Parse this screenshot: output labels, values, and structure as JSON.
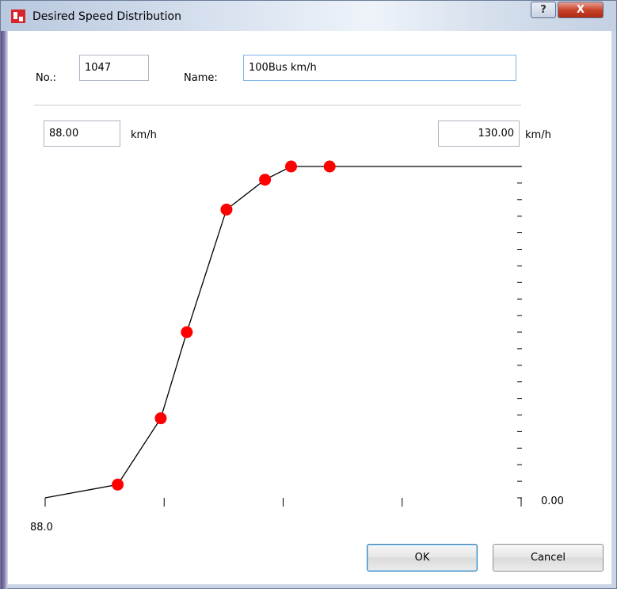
{
  "window": {
    "title": "Desired Speed Distribution",
    "help_label": "?",
    "close_label": "X"
  },
  "form": {
    "no_label": "No.:",
    "no_value": "1047",
    "name_label": "Name:",
    "name_value": "100Bus km/h"
  },
  "range": {
    "min_value": "88.00",
    "max_value": "130.00",
    "unit": "km/h"
  },
  "chart_data": {
    "type": "line",
    "x_min": 88.0,
    "x_max": 130.0,
    "y_min": 0.0,
    "y_max": 1.0,
    "x_tick_label": "88.0",
    "y_tick_label": "0.00",
    "x_ticks": [
      88.0,
      98.5,
      109.0,
      119.5,
      130.0
    ],
    "y_ticks": [
      0.0,
      0.05,
      0.1,
      0.15,
      0.2,
      0.25,
      0.3,
      0.35,
      0.4,
      0.45,
      0.5,
      0.55,
      0.6,
      0.65,
      0.7,
      0.75,
      0.8,
      0.85,
      0.9,
      0.95,
      1.0
    ],
    "points": [
      {
        "x": 88.0,
        "y": 0.0
      },
      {
        "x": 94.4,
        "y": 0.04
      },
      {
        "x": 98.2,
        "y": 0.24
      },
      {
        "x": 100.5,
        "y": 0.5
      },
      {
        "x": 104.0,
        "y": 0.87
      },
      {
        "x": 107.4,
        "y": 0.96
      },
      {
        "x": 109.7,
        "y": 1.0
      },
      {
        "x": 113.1,
        "y": 1.0
      },
      {
        "x": 130.0,
        "y": 1.0
      }
    ],
    "marked_points": [
      1,
      2,
      3,
      4,
      5,
      6,
      7
    ],
    "line_color": "#000000",
    "marker_color": "#ff0000"
  },
  "buttons": {
    "ok_label": "OK",
    "cancel_label": "Cancel"
  }
}
